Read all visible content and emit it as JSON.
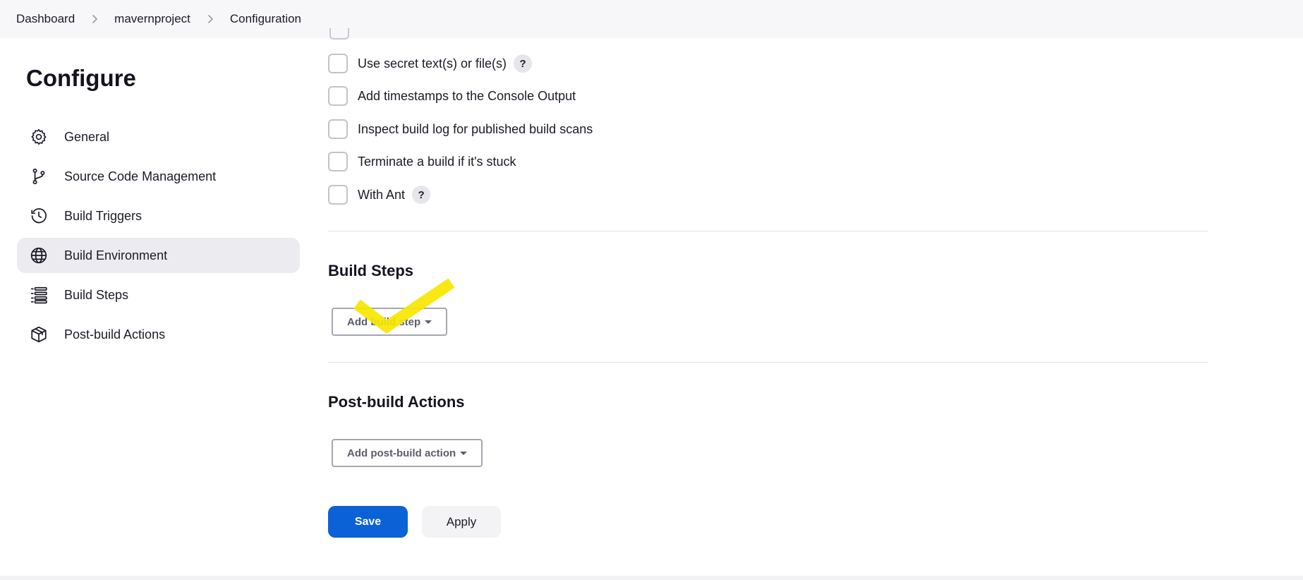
{
  "breadcrumb": {
    "items": [
      "Dashboard",
      "mavernproject",
      "Configuration"
    ]
  },
  "page": {
    "title": "Configure"
  },
  "sidebar": {
    "items": [
      {
        "label": "General",
        "icon": "gear-icon",
        "active": false
      },
      {
        "label": "Source Code Management",
        "icon": "branch-icon",
        "active": false
      },
      {
        "label": "Build Triggers",
        "icon": "clock-icon",
        "active": false
      },
      {
        "label": "Build Environment",
        "icon": "globe-icon",
        "active": true
      },
      {
        "label": "Build Steps",
        "icon": "list-icon",
        "active": false
      },
      {
        "label": "Post-build Actions",
        "icon": "package-icon",
        "active": false
      }
    ]
  },
  "build_environment": {
    "options": [
      {
        "label": "Use secret text(s) or file(s)",
        "checked": false,
        "help": "?"
      },
      {
        "label": "Add timestamps to the Console Output",
        "checked": false
      },
      {
        "label": "Inspect build log for published build scans",
        "checked": false
      },
      {
        "label": "Terminate a build if it's stuck",
        "checked": false
      },
      {
        "label": "With Ant",
        "checked": false,
        "help": "?"
      }
    ]
  },
  "build_steps": {
    "title": "Build Steps",
    "add_button": "Add build step"
  },
  "post_build": {
    "title": "Post-build Actions",
    "add_button": "Add post-build action"
  },
  "actions": {
    "save": "Save",
    "apply": "Apply"
  },
  "colors": {
    "primary": "#0b62d6",
    "active_nav_bg": "#ececf0",
    "annotation": "#f7e600"
  }
}
